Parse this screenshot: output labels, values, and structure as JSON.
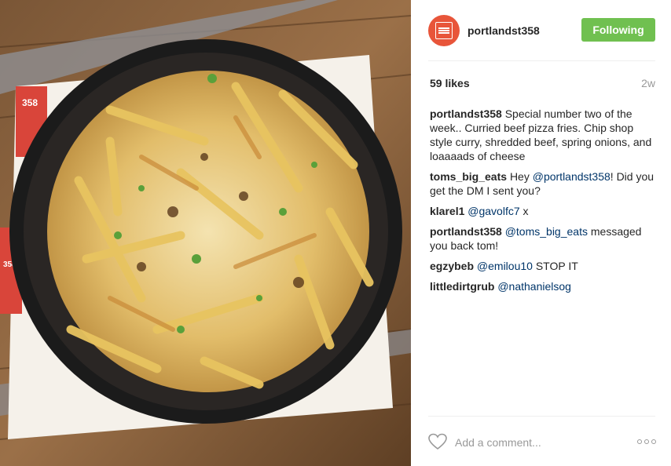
{
  "post": {
    "username": "portlandst358",
    "follow_label": "Following",
    "likes": "59 likes",
    "time": "2w",
    "comment_placeholder": "Add a comment...",
    "photo_alt": "Curried beef pizza fries"
  },
  "comments": [
    {
      "user": "portlandst358",
      "mention": "",
      "text": "Special number two of the week.. Curried beef pizza fries. Chip shop style curry, shredded beef, spring onions, and loaaaads of cheese"
    },
    {
      "user": "toms_big_eats",
      "pre": "Hey",
      "mention": "@portlandst358",
      "text": "! Did you get the DM I sent you?"
    },
    {
      "user": "klarel1",
      "pre": "",
      "mention": "@gavolfc7",
      "text": "x"
    },
    {
      "user": "portlandst358",
      "pre": "",
      "mention": "@toms_big_eats",
      "text": "messaged you back tom!"
    },
    {
      "user": "egzybeb",
      "pre": "",
      "mention": "@emilou10",
      "text": "STOP IT"
    },
    {
      "user": "littledirtgrub",
      "pre": "",
      "mention": "@nathanielsog",
      "text": ""
    }
  ],
  "photo_labels": {
    "tag_top": "358",
    "tag_side": "358"
  },
  "icons": [
    "heart-icon",
    "more-options-icon",
    "avatar-logo-icon"
  ],
  "colors": {
    "follow": "#70c050",
    "mention": "#003569",
    "muted": "#999999",
    "brand": "#e8553a"
  }
}
